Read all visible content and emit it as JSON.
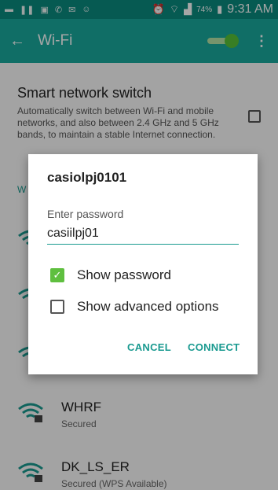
{
  "status_bar": {
    "battery": "74%",
    "time": "9:31 AM"
  },
  "app_bar": {
    "back_icon": "arrow-left-icon",
    "title": "Wi-Fi",
    "toggle_on": true,
    "menu_icon": "more-vert-icon"
  },
  "smart_switch": {
    "title": "Smart network switch",
    "description": "Automatically switch between Wi-Fi and mobile networks, and also between 2.4 GHz and 5 GHz bands, to maintain a stable Internet connection.",
    "checked": false
  },
  "section_label": "W",
  "networks": [
    {
      "name": "WHRF",
      "status": "Secured"
    },
    {
      "name": "DK_LS_ER",
      "status": "Secured (WPS Available)"
    }
  ],
  "dialog": {
    "title": "casiolpj0101",
    "password_label": "Enter password",
    "password_value": "casiilpj01",
    "show_password_label": "Show password",
    "show_password_checked": true,
    "show_advanced_label": "Show advanced options",
    "show_advanced_checked": false,
    "cancel_label": "CANCEL",
    "connect_label": "CONNECT"
  },
  "colors": {
    "status_bar": "#0a8a7f",
    "app_bar": "#19a99d",
    "accent": "#1a9a90",
    "check": "#5fbf3f"
  }
}
